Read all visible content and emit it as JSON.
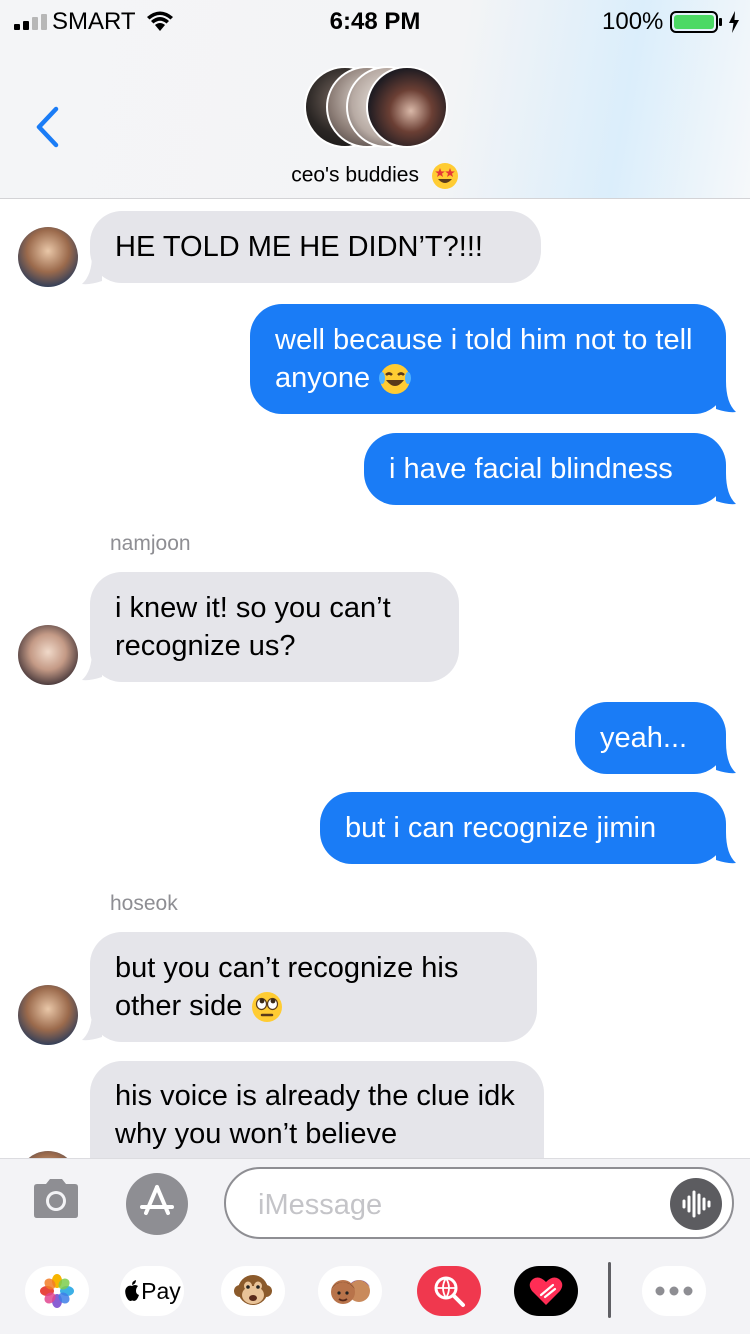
{
  "status_bar": {
    "carrier": "SMART",
    "time": "6:48 PM",
    "battery_percent": "100%"
  },
  "header": {
    "group_name": "ceo's buddies",
    "group_emoji": "star-struck-emoji-icon"
  },
  "messages": [
    {
      "side": "incoming",
      "text": "HE TOLD ME HE DIDN’T?!!!"
    },
    {
      "side": "outgoing",
      "text": "well because i told him not to tell anyone",
      "emoji": "tears-of-joy-emoji-icon"
    },
    {
      "side": "outgoing",
      "text": "i have facial blindness"
    },
    {
      "side": "incoming",
      "sender": "namjoon",
      "text": "i knew it! so you can’t recognize us?"
    },
    {
      "side": "outgoing",
      "text": "yeah..."
    },
    {
      "side": "outgoing",
      "text": "but i can recognize jimin"
    },
    {
      "side": "incoming",
      "sender": "hoseok",
      "text": "but you can’t recognize his other side",
      "emoji": "rolling-eyes-emoji-icon"
    },
    {
      "side": "incoming",
      "text": "his voice is already the clue idk why you won’t believe"
    }
  ],
  "input": {
    "placeholder": "iMessage"
  },
  "dock": {
    "apple_pay_label": "Pay"
  },
  "colors": {
    "outgoing_bubble": "#1a7cf6",
    "incoming_bubble": "#e5e5ea",
    "accent": "#1a7cf6"
  }
}
